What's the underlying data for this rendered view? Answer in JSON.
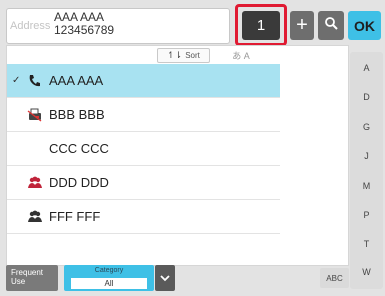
{
  "address": {
    "caption": "Address",
    "name": "AAA AAA",
    "number": "123456789"
  },
  "toolbar": {
    "count": "1",
    "add_glyph": "+",
    "search_icon": "search-icon",
    "ok_label": "OK"
  },
  "sort": {
    "label": "Sort",
    "kana": "あ A"
  },
  "list": [
    {
      "name": "AAA AAA",
      "icon": "phone-icon",
      "selected": true
    },
    {
      "name": "BBB BBB",
      "icon": "fax-icon",
      "selected": false
    },
    {
      "name": "CCC CCC",
      "icon": "",
      "selected": false
    },
    {
      "name": "DDD DDD",
      "icon": "group-icon",
      "selected": false
    },
    {
      "name": "FFF FFF",
      "icon": "group-icon",
      "selected": false
    }
  ],
  "index": [
    "A",
    "D",
    "G",
    "J",
    "M",
    "P",
    "T",
    "W"
  ],
  "bottom": {
    "frequent_line1": "Frequent",
    "frequent_line2": "Use",
    "category_caption": "Category",
    "category_value": "All",
    "abc_label": "ABC"
  },
  "colors": {
    "accent": "#3ec0e6",
    "selected_row": "#a8e2f1",
    "highlight": "#e01a32"
  }
}
